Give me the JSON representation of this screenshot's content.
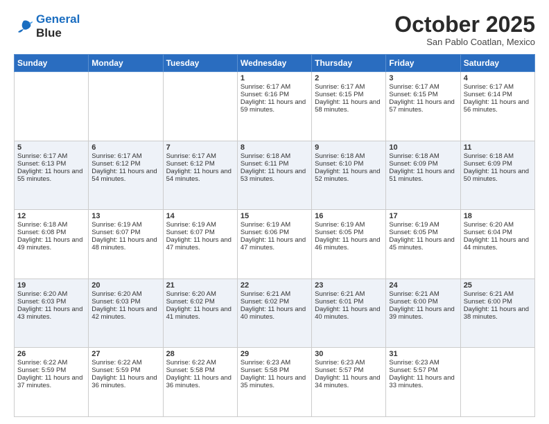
{
  "header": {
    "logo_line1": "General",
    "logo_line2": "Blue",
    "month": "October 2025",
    "location": "San Pablo Coatlan, Mexico"
  },
  "days_of_week": [
    "Sunday",
    "Monday",
    "Tuesday",
    "Wednesday",
    "Thursday",
    "Friday",
    "Saturday"
  ],
  "weeks": [
    [
      {
        "day": "",
        "sunrise": "",
        "sunset": "",
        "daylight": ""
      },
      {
        "day": "",
        "sunrise": "",
        "sunset": "",
        "daylight": ""
      },
      {
        "day": "",
        "sunrise": "",
        "sunset": "",
        "daylight": ""
      },
      {
        "day": "1",
        "sunrise": "Sunrise: 6:17 AM",
        "sunset": "Sunset: 6:16 PM",
        "daylight": "Daylight: 11 hours and 59 minutes."
      },
      {
        "day": "2",
        "sunrise": "Sunrise: 6:17 AM",
        "sunset": "Sunset: 6:15 PM",
        "daylight": "Daylight: 11 hours and 58 minutes."
      },
      {
        "day": "3",
        "sunrise": "Sunrise: 6:17 AM",
        "sunset": "Sunset: 6:15 PM",
        "daylight": "Daylight: 11 hours and 57 minutes."
      },
      {
        "day": "4",
        "sunrise": "Sunrise: 6:17 AM",
        "sunset": "Sunset: 6:14 PM",
        "daylight": "Daylight: 11 hours and 56 minutes."
      }
    ],
    [
      {
        "day": "5",
        "sunrise": "Sunrise: 6:17 AM",
        "sunset": "Sunset: 6:13 PM",
        "daylight": "Daylight: 11 hours and 55 minutes."
      },
      {
        "day": "6",
        "sunrise": "Sunrise: 6:17 AM",
        "sunset": "Sunset: 6:12 PM",
        "daylight": "Daylight: 11 hours and 54 minutes."
      },
      {
        "day": "7",
        "sunrise": "Sunrise: 6:17 AM",
        "sunset": "Sunset: 6:12 PM",
        "daylight": "Daylight: 11 hours and 54 minutes."
      },
      {
        "day": "8",
        "sunrise": "Sunrise: 6:18 AM",
        "sunset": "Sunset: 6:11 PM",
        "daylight": "Daylight: 11 hours and 53 minutes."
      },
      {
        "day": "9",
        "sunrise": "Sunrise: 6:18 AM",
        "sunset": "Sunset: 6:10 PM",
        "daylight": "Daylight: 11 hours and 52 minutes."
      },
      {
        "day": "10",
        "sunrise": "Sunrise: 6:18 AM",
        "sunset": "Sunset: 6:09 PM",
        "daylight": "Daylight: 11 hours and 51 minutes."
      },
      {
        "day": "11",
        "sunrise": "Sunrise: 6:18 AM",
        "sunset": "Sunset: 6:09 PM",
        "daylight": "Daylight: 11 hours and 50 minutes."
      }
    ],
    [
      {
        "day": "12",
        "sunrise": "Sunrise: 6:18 AM",
        "sunset": "Sunset: 6:08 PM",
        "daylight": "Daylight: 11 hours and 49 minutes."
      },
      {
        "day": "13",
        "sunrise": "Sunrise: 6:19 AM",
        "sunset": "Sunset: 6:07 PM",
        "daylight": "Daylight: 11 hours and 48 minutes."
      },
      {
        "day": "14",
        "sunrise": "Sunrise: 6:19 AM",
        "sunset": "Sunset: 6:07 PM",
        "daylight": "Daylight: 11 hours and 47 minutes."
      },
      {
        "day": "15",
        "sunrise": "Sunrise: 6:19 AM",
        "sunset": "Sunset: 6:06 PM",
        "daylight": "Daylight: 11 hours and 47 minutes."
      },
      {
        "day": "16",
        "sunrise": "Sunrise: 6:19 AM",
        "sunset": "Sunset: 6:05 PM",
        "daylight": "Daylight: 11 hours and 46 minutes."
      },
      {
        "day": "17",
        "sunrise": "Sunrise: 6:19 AM",
        "sunset": "Sunset: 6:05 PM",
        "daylight": "Daylight: 11 hours and 45 minutes."
      },
      {
        "day": "18",
        "sunrise": "Sunrise: 6:20 AM",
        "sunset": "Sunset: 6:04 PM",
        "daylight": "Daylight: 11 hours and 44 minutes."
      }
    ],
    [
      {
        "day": "19",
        "sunrise": "Sunrise: 6:20 AM",
        "sunset": "Sunset: 6:03 PM",
        "daylight": "Daylight: 11 hours and 43 minutes."
      },
      {
        "day": "20",
        "sunrise": "Sunrise: 6:20 AM",
        "sunset": "Sunset: 6:03 PM",
        "daylight": "Daylight: 11 hours and 42 minutes."
      },
      {
        "day": "21",
        "sunrise": "Sunrise: 6:20 AM",
        "sunset": "Sunset: 6:02 PM",
        "daylight": "Daylight: 11 hours and 41 minutes."
      },
      {
        "day": "22",
        "sunrise": "Sunrise: 6:21 AM",
        "sunset": "Sunset: 6:02 PM",
        "daylight": "Daylight: 11 hours and 40 minutes."
      },
      {
        "day": "23",
        "sunrise": "Sunrise: 6:21 AM",
        "sunset": "Sunset: 6:01 PM",
        "daylight": "Daylight: 11 hours and 40 minutes."
      },
      {
        "day": "24",
        "sunrise": "Sunrise: 6:21 AM",
        "sunset": "Sunset: 6:00 PM",
        "daylight": "Daylight: 11 hours and 39 minutes."
      },
      {
        "day": "25",
        "sunrise": "Sunrise: 6:21 AM",
        "sunset": "Sunset: 6:00 PM",
        "daylight": "Daylight: 11 hours and 38 minutes."
      }
    ],
    [
      {
        "day": "26",
        "sunrise": "Sunrise: 6:22 AM",
        "sunset": "Sunset: 5:59 PM",
        "daylight": "Daylight: 11 hours and 37 minutes."
      },
      {
        "day": "27",
        "sunrise": "Sunrise: 6:22 AM",
        "sunset": "Sunset: 5:59 PM",
        "daylight": "Daylight: 11 hours and 36 minutes."
      },
      {
        "day": "28",
        "sunrise": "Sunrise: 6:22 AM",
        "sunset": "Sunset: 5:58 PM",
        "daylight": "Daylight: 11 hours and 36 minutes."
      },
      {
        "day": "29",
        "sunrise": "Sunrise: 6:23 AM",
        "sunset": "Sunset: 5:58 PM",
        "daylight": "Daylight: 11 hours and 35 minutes."
      },
      {
        "day": "30",
        "sunrise": "Sunrise: 6:23 AM",
        "sunset": "Sunset: 5:57 PM",
        "daylight": "Daylight: 11 hours and 34 minutes."
      },
      {
        "day": "31",
        "sunrise": "Sunrise: 6:23 AM",
        "sunset": "Sunset: 5:57 PM",
        "daylight": "Daylight: 11 hours and 33 minutes."
      },
      {
        "day": "",
        "sunrise": "",
        "sunset": "",
        "daylight": ""
      }
    ]
  ]
}
